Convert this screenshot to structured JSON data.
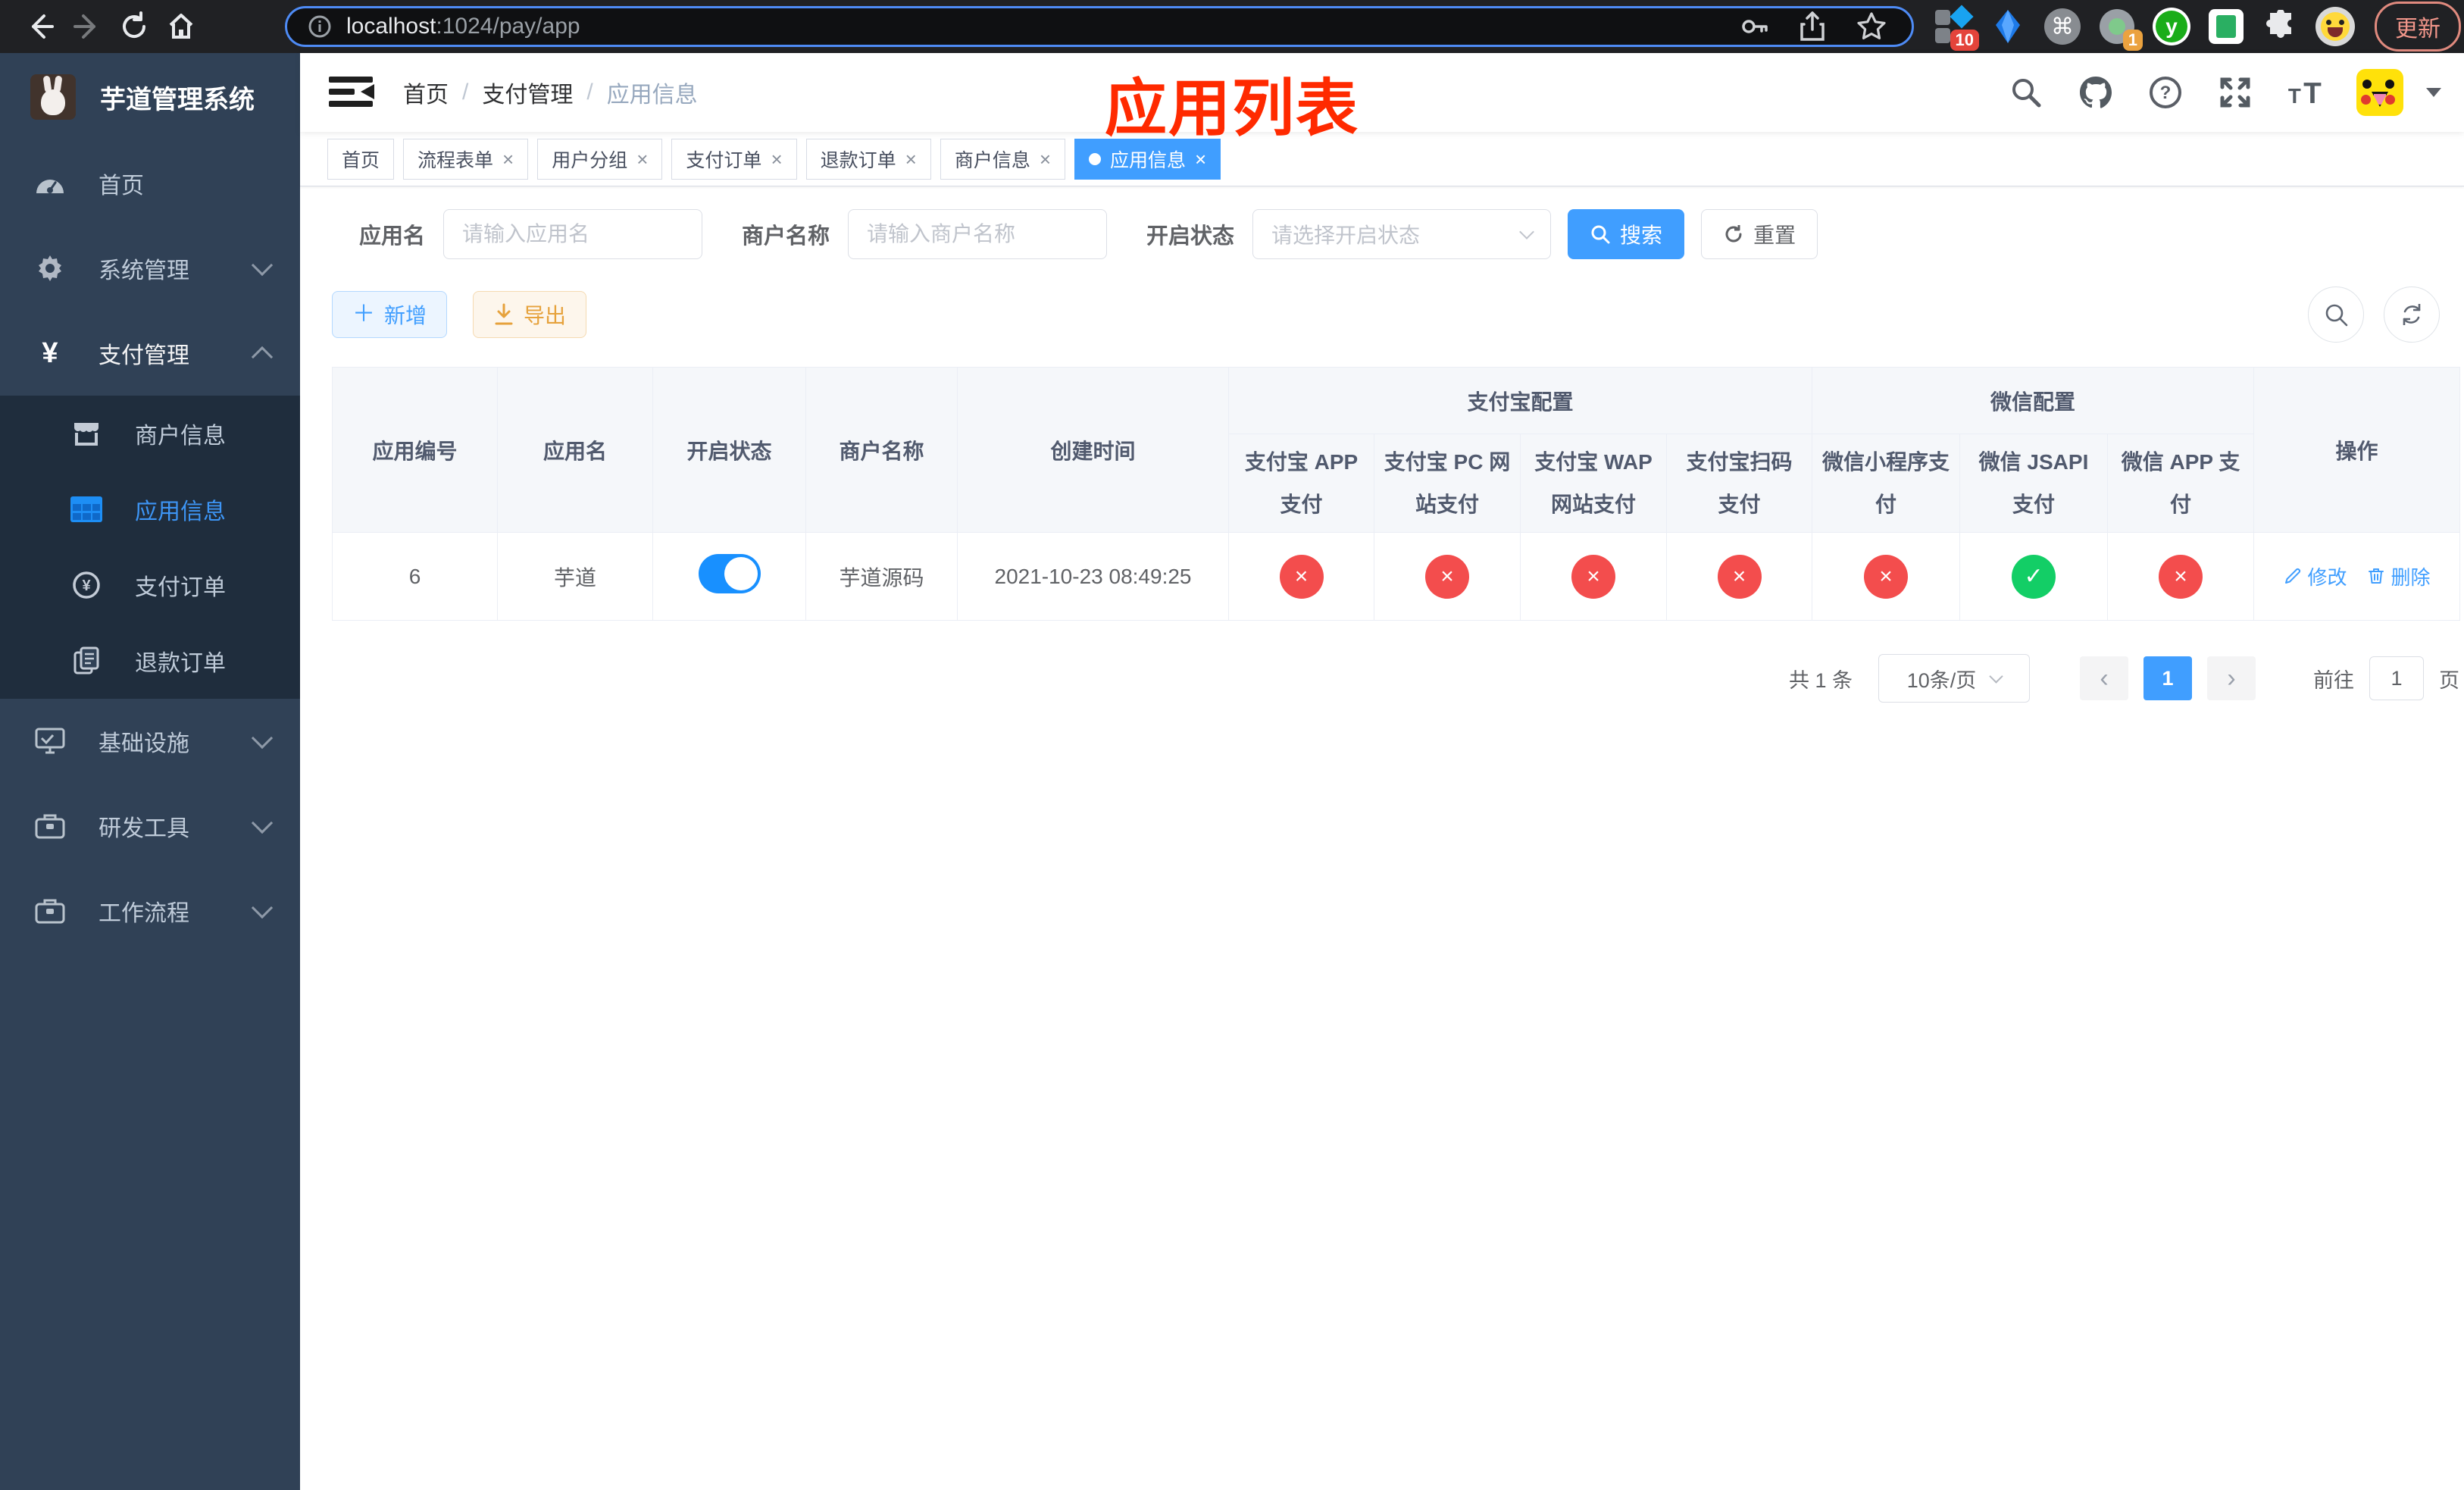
{
  "colors": {
    "accent": "#409eff",
    "danger": "#f34d4d",
    "success": "#13ce66",
    "warning": "#e6a23c",
    "sidebar_bg": "#304156",
    "submenu_bg": "#1f2d3d",
    "tab_active": "#409eff",
    "annotation_red": "#ff2a00"
  },
  "browser": {
    "url_host": "localhost",
    "url_rest": ":1024/pay/app",
    "update_label": "更新",
    "ext_badge_a": "10",
    "ext_badge_b": "1",
    "ext_y": "y"
  },
  "sidebar": {
    "title": "芋道管理系统",
    "items": [
      {
        "label": "首页"
      },
      {
        "label": "系统管理"
      },
      {
        "label": "支付管理"
      },
      {
        "label": "基础设施"
      },
      {
        "label": "研发工具"
      },
      {
        "label": "工作流程"
      }
    ],
    "payment_children": [
      {
        "label": "商户信息"
      },
      {
        "label": "应用信息"
      },
      {
        "label": "支付订单"
      },
      {
        "label": "退款订单"
      }
    ]
  },
  "navbar": {
    "breadcrumb": [
      "首页",
      "支付管理",
      "应用信息"
    ],
    "separator": "/"
  },
  "overlay_title": "应用列表",
  "tabs": [
    {
      "label": "首页"
    },
    {
      "label": "流程表单"
    },
    {
      "label": "用户分组"
    },
    {
      "label": "支付订单"
    },
    {
      "label": "退款订单"
    },
    {
      "label": "商户信息"
    },
    {
      "label": "应用信息"
    }
  ],
  "filters": {
    "app_name_label": "应用名",
    "app_name_placeholder": "请输入应用名",
    "merchant_label": "商户名称",
    "merchant_placeholder": "请输入商户名称",
    "status_label": "开启状态",
    "status_placeholder": "请选择开启状态",
    "search_label": "搜索",
    "reset_label": "重置"
  },
  "toolbar": {
    "add_label": "新增",
    "export_label": "导出"
  },
  "table": {
    "simple_cols": [
      "应用编号",
      "应用名",
      "开启状态",
      "商户名称",
      "创建时间"
    ],
    "alipay_group": "支付宝配置",
    "wechat_group": "微信配置",
    "alipay_cols": [
      "支付宝 APP 支付",
      "支付宝 PC 网站支付",
      "支付宝 WAP 网站支付",
      "支付宝扫码支付"
    ],
    "wechat_cols": [
      "微信小程序支付",
      "微信 JSAPI 支付",
      "微信 APP 支付"
    ],
    "action_col": "操作",
    "row": {
      "id": "6",
      "name": "芋道",
      "enabled": true,
      "merchant": "芋道源码",
      "created_at": "2021-10-23 08:49:25",
      "channels": [
        false,
        false,
        false,
        false,
        false,
        true,
        false
      ],
      "cross_glyph": "×",
      "check_glyph": "✓",
      "edit_label": "修改",
      "delete_label": "删除"
    }
  },
  "pagination": {
    "total": "共 1 条",
    "page_size": "10条/页",
    "current_page": "1",
    "prev_glyph": "‹",
    "next_glyph": "›",
    "goto_prefix": "前往",
    "goto_value": "1",
    "goto_suffix": "页"
  }
}
